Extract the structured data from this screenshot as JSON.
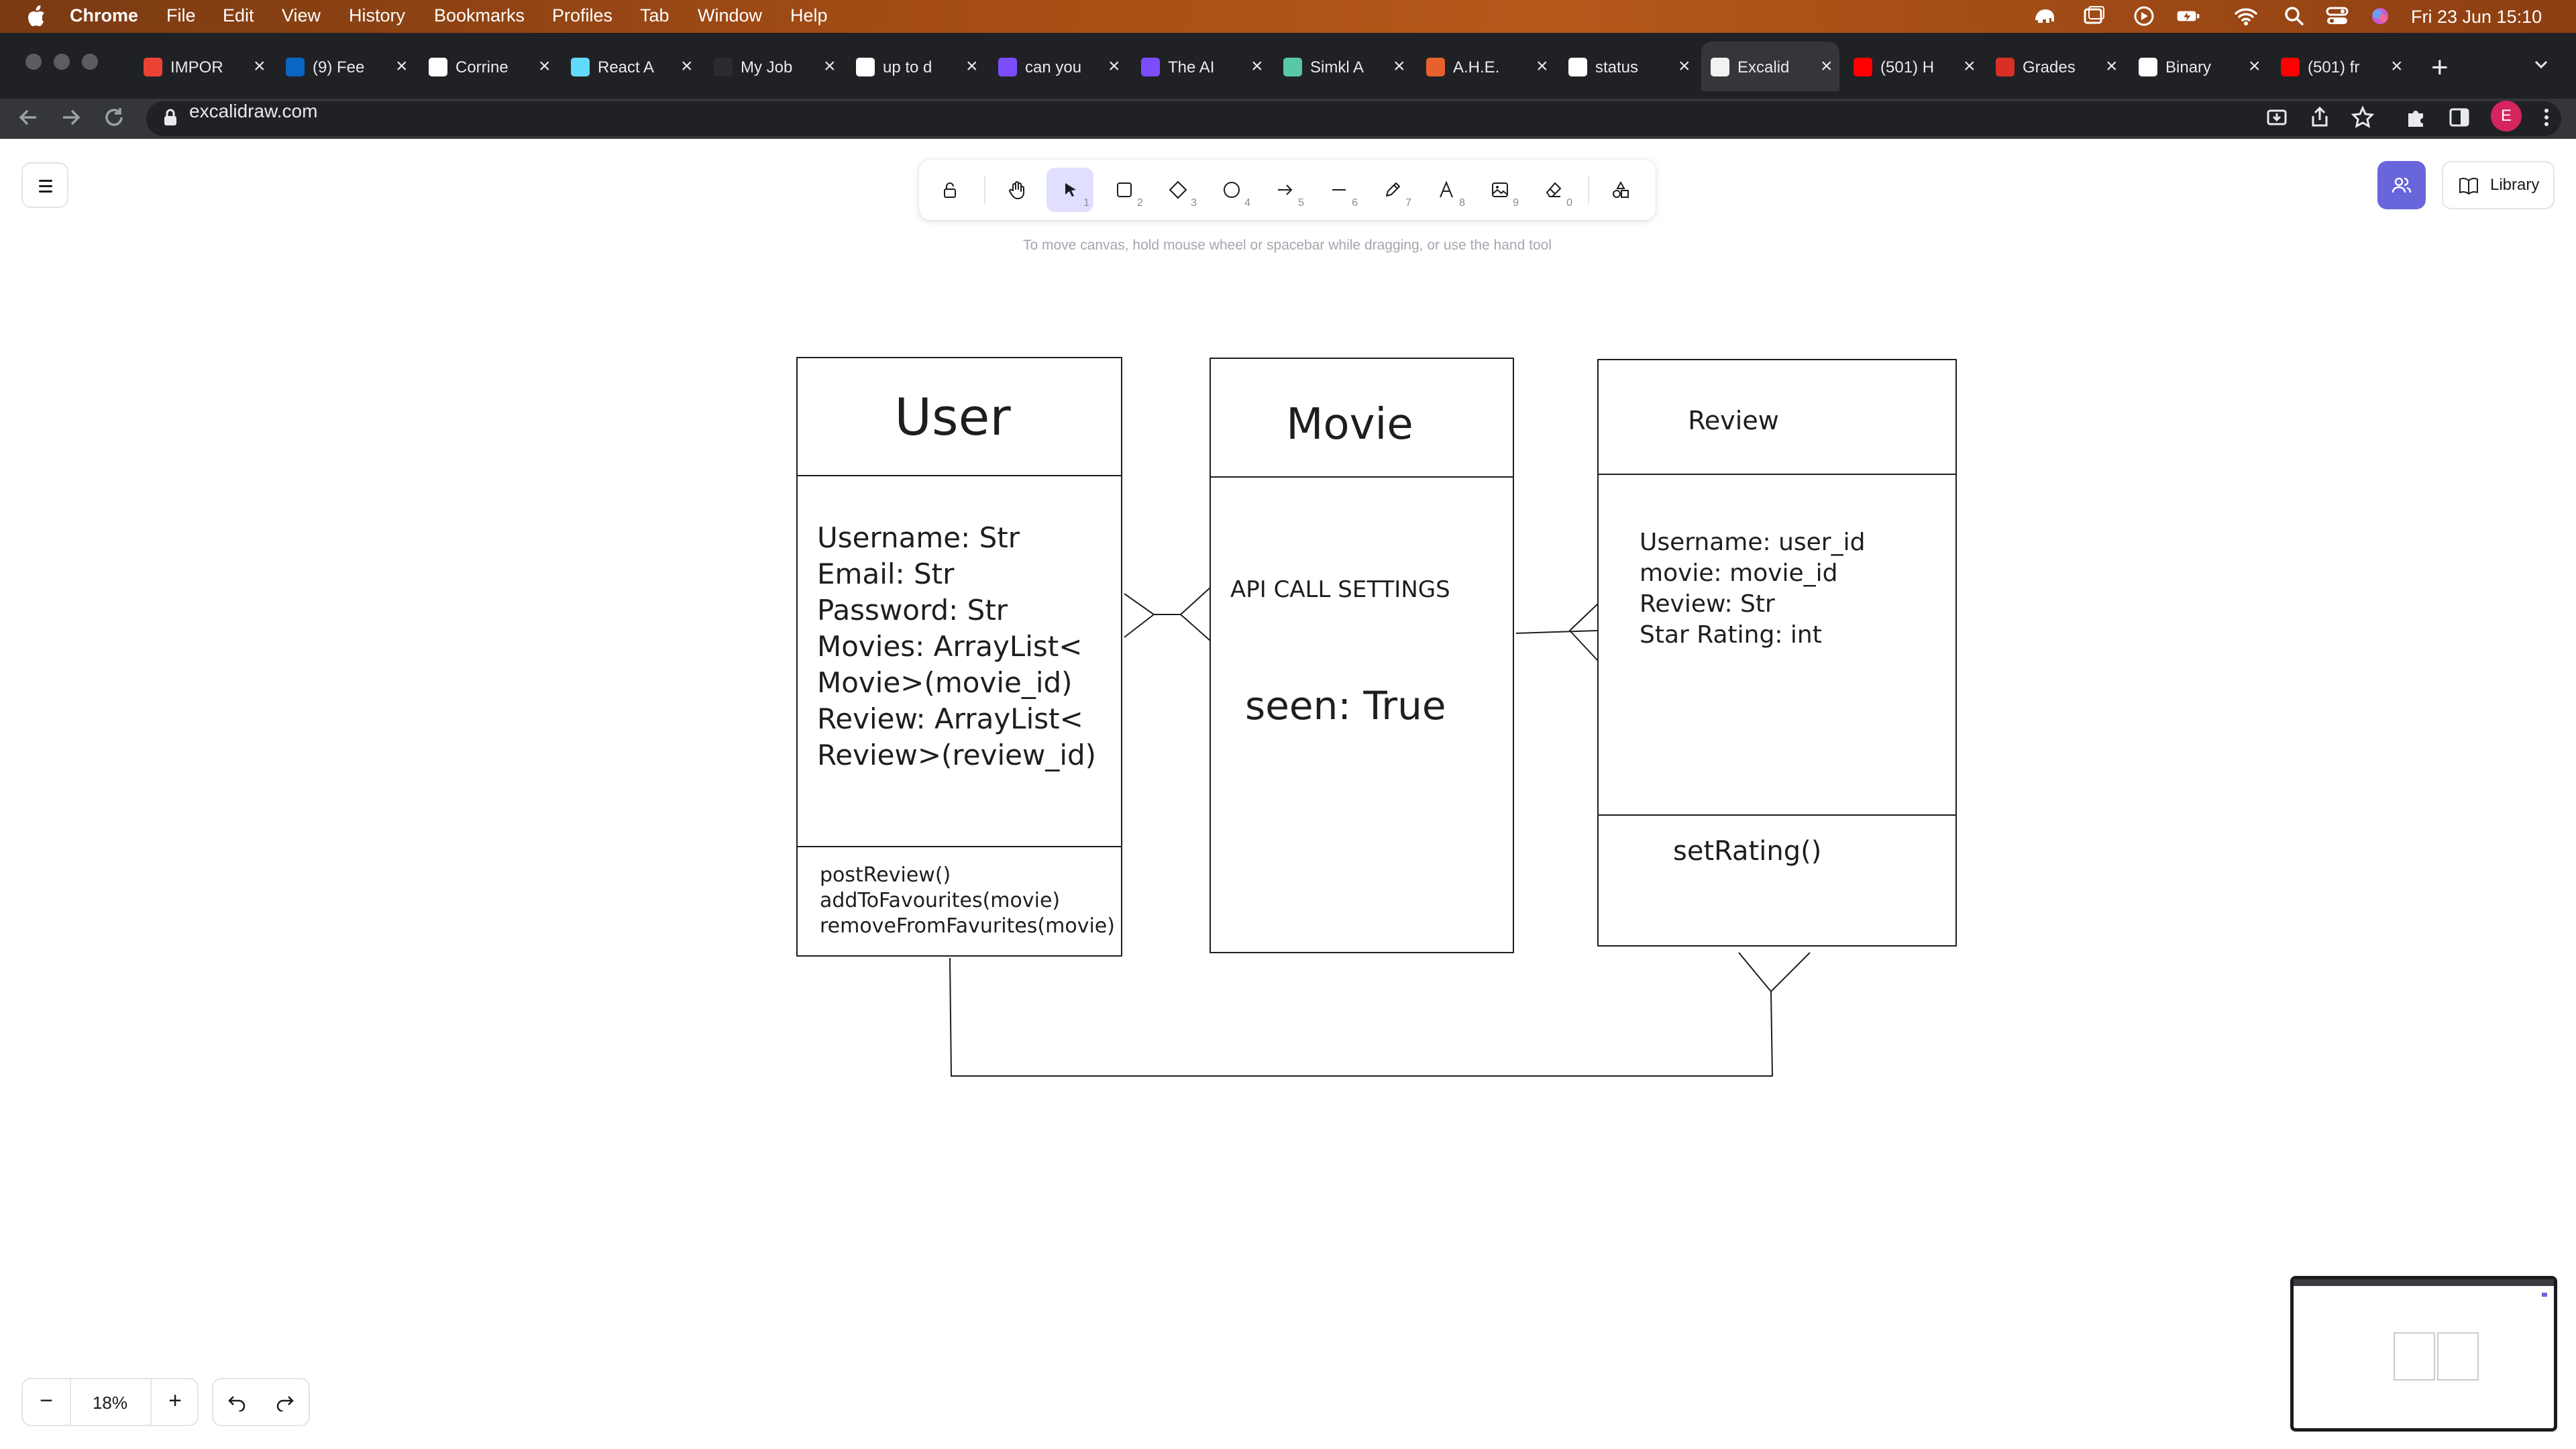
{
  "os_menubar": {
    "app_name": "Chrome",
    "menus": [
      "File",
      "Edit",
      "View",
      "History",
      "Bookmarks",
      "Profiles",
      "Tab",
      "Window",
      "Help"
    ],
    "clock": "Fri 23 Jun  15:10"
  },
  "browser": {
    "tabs": [
      {
        "title": "IMPOR",
        "favicon": "gmail-icon",
        "color": "#ea4335"
      },
      {
        "title": "(9) Fee",
        "favicon": "linkedin-icon",
        "color": "#0a66c2"
      },
      {
        "title": "Corrine",
        "favicon": "github-icon",
        "color": "#ffffff"
      },
      {
        "title": "React A",
        "favicon": "react-icon",
        "color": "#61dafb"
      },
      {
        "title": "My Job",
        "favicon": "blank-icon",
        "color": "#2b2c30"
      },
      {
        "title": "up to d",
        "favicon": "google-icon",
        "color": "#ffffff"
      },
      {
        "title": "can you",
        "favicon": "bird-icon",
        "color": "#7c4dff"
      },
      {
        "title": "The AI",
        "favicon": "bird-icon",
        "color": "#7c4dff"
      },
      {
        "title": "Simkl A",
        "favicon": "heart-icon",
        "color": "#5ac8a8"
      },
      {
        "title": "A.H.E.",
        "favicon": "trello-icon",
        "color": "#e8612c"
      },
      {
        "title": "status",
        "favicon": "google-icon",
        "color": "#ffffff"
      },
      {
        "title": "Excalid",
        "favicon": "excalidraw-icon",
        "color": "#f2f2f2",
        "active": true
      },
      {
        "title": "(501) H",
        "favicon": "youtube-icon",
        "color": "#ff0000"
      },
      {
        "title": "Grades",
        "favicon": "dots-icon",
        "color": "#d93025"
      },
      {
        "title": "Binary",
        "favicon": "medium-icon",
        "color": "#ffffff"
      },
      {
        "title": "(501) fr",
        "favicon": "youtube-icon",
        "color": "#ff0000"
      }
    ],
    "url": "excalidraw.com",
    "profile_initial": "E"
  },
  "excalidraw": {
    "tools": [
      {
        "name": "lock-tool",
        "key": ""
      },
      {
        "name": "hand-tool",
        "key": ""
      },
      {
        "name": "selection-tool",
        "key": "1",
        "selected": true
      },
      {
        "name": "rectangle-tool",
        "key": "2"
      },
      {
        "name": "diamond-tool",
        "key": "3"
      },
      {
        "name": "ellipse-tool",
        "key": "4"
      },
      {
        "name": "arrow-tool",
        "key": "5"
      },
      {
        "name": "line-tool",
        "key": "6"
      },
      {
        "name": "draw-tool",
        "key": "7"
      },
      {
        "name": "text-tool",
        "key": "8"
      },
      {
        "name": "image-tool",
        "key": "9"
      },
      {
        "name": "eraser-tool",
        "key": "0"
      },
      {
        "name": "extra-tools",
        "key": ""
      }
    ],
    "hint": "To move canvas, hold mouse wheel or spacebar while dragging, or use the hand tool",
    "library_label": "Library",
    "zoom": "18%",
    "accent": "#6965db"
  },
  "diagram": {
    "user": {
      "title": "User",
      "attributes": [
        "Username: Str",
        "Email: Str",
        "Password: Str",
        "Movies: ArrayList<",
        "Movie>(movie_id)",
        "Review: ArrayList<",
        "Review>(review_id)"
      ],
      "methods": [
        "postReview()",
        "addToFavourites(movie)",
        "removeFromFavurites(movie)"
      ]
    },
    "movie": {
      "title": "Movie",
      "line1": "API CALL SETTINGS",
      "line2": "seen: True"
    },
    "review": {
      "title": "Review",
      "attributes": [
        "Username: user_id",
        "movie: movie_id",
        "Review: Str",
        "Star Rating: int"
      ],
      "methods": [
        "setRating()"
      ]
    }
  }
}
